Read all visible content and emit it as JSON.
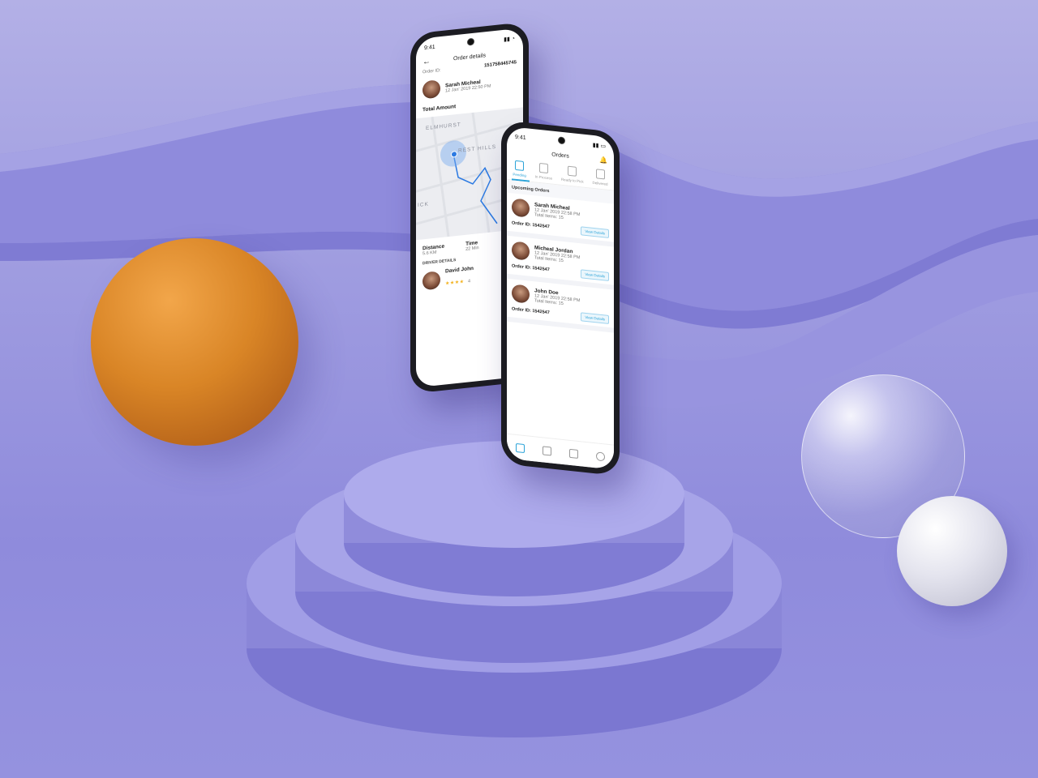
{
  "order_details_screen": {
    "status_time": "9:41",
    "title": "Order details",
    "order_id_label": "Order ID:",
    "order_id_value": "151758445745",
    "customer": {
      "name": "Sarah Micheal",
      "date": "12 Jan' 2019 22:50 PM"
    },
    "total_amount_label": "Total Amount",
    "map_labels": [
      "ELMHURST",
      "REST HILLS",
      "ICK"
    ],
    "distance_label": "Distance",
    "distance_value": "5.6 KM",
    "time_label": "Time",
    "time_value": "22 Min",
    "driver_details_label": "DRIVER DETAILS",
    "driver": {
      "name": "David John",
      "rating_stars": "★★★★",
      "rating_value": "4"
    }
  },
  "orders_screen": {
    "status_time": "9:41",
    "title": "Orders",
    "tabs": [
      {
        "label": "Pending",
        "active": true
      },
      {
        "label": "In Process",
        "active": false
      },
      {
        "label": "Ready to Pick",
        "active": false
      },
      {
        "label": "Delivered",
        "active": false
      }
    ],
    "section_title": "Upcoming Orders",
    "orders": [
      {
        "name": "Sarah Micheal",
        "date": "12 Jan' 2019 22:58 PM",
        "items": "Total Items: 15",
        "order_id": "Order ID: 1542547",
        "button": "View Details"
      },
      {
        "name": "Micheal Jordan",
        "date": "12 Jan' 2019 22:58 PM",
        "items": "Total Items: 15",
        "order_id": "Order ID: 1542547",
        "button": "View Details"
      },
      {
        "name": "John Doe",
        "date": "12 Jan' 2019 22:58 PM",
        "items": "Total Items: 15",
        "order_id": "Order ID: 1542547",
        "button": "View Details"
      }
    ],
    "bottom_nav": [
      "orders-icon",
      "wallet-icon",
      "box-icon",
      "profile-icon"
    ]
  },
  "colors": {
    "accent": "#2ba3d8",
    "background": "#9f9ce0",
    "orange_sphere": "#d98526"
  }
}
